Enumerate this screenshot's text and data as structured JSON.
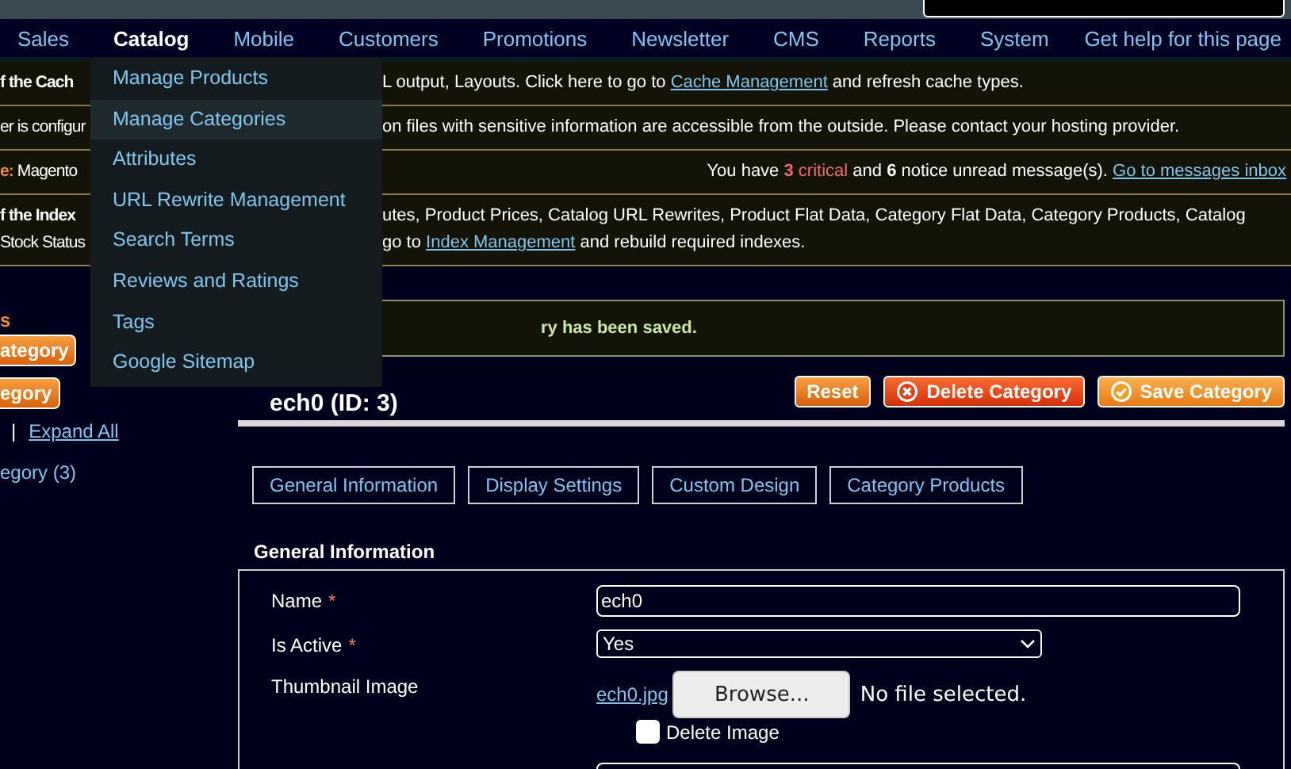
{
  "nav": {
    "items": [
      {
        "label": "Sales",
        "selected": false
      },
      {
        "label": "Catalog",
        "selected": true
      },
      {
        "label": "Mobile",
        "selected": false
      },
      {
        "label": "Customers",
        "selected": false
      },
      {
        "label": "Promotions",
        "selected": false
      },
      {
        "label": "Newsletter",
        "selected": false
      },
      {
        "label": "CMS",
        "selected": false
      },
      {
        "label": "Reports",
        "selected": false
      },
      {
        "label": "System",
        "selected": false
      }
    ],
    "help": "Get help for this page"
  },
  "catalog_menu": {
    "items": [
      {
        "label": "Manage Products",
        "selected": false
      },
      {
        "label": "Manage Categories",
        "selected": true
      },
      {
        "label": "Attributes",
        "selected": false
      },
      {
        "label": "URL Rewrite Management",
        "selected": false
      },
      {
        "label": "Search Terms",
        "selected": false
      },
      {
        "label": "Reviews and Ratings",
        "selected": false
      },
      {
        "label": "Tags",
        "selected": false
      },
      {
        "label": "Google Sitemap",
        "selected": false
      }
    ]
  },
  "messages": [
    {
      "kind": "notice",
      "left": [
        [
          {
            "kind": "bold",
            "text": "f the Cach"
          }
        ]
      ],
      "right": [
        [
          {
            "kind": "text",
            "text": "L output, Layouts. Click here to go to "
          },
          {
            "kind": "link",
            "text": "Cache Management"
          },
          {
            "kind": "text",
            "text": " and refresh cache types."
          }
        ]
      ]
    },
    {
      "kind": "notice",
      "left": [
        [
          {
            "kind": "text",
            "text": "er is configur"
          }
        ]
      ],
      "right": [
        [
          {
            "kind": "text",
            "text": "on files with sensitive information are accessible from the outside. Please contact your hosting provider."
          }
        ]
      ]
    },
    {
      "kind": "inbox",
      "left": [
        [
          {
            "kind": "label",
            "text": "e:"
          },
          {
            "kind": "text",
            "text": " Magento"
          }
        ]
      ],
      "right": [
        [
          {
            "kind": "text",
            "text": "You have "
          },
          {
            "kind": "critical-count",
            "text": "3"
          },
          {
            "kind": "critical",
            "text": " critical"
          },
          {
            "kind": "text",
            "text": " and "
          },
          {
            "kind": "bold",
            "text": "6"
          },
          {
            "kind": "text",
            "text": " notice unread message(s). "
          },
          {
            "kind": "link",
            "text": "Go to messages inbox"
          }
        ]
      ]
    },
    {
      "kind": "notice",
      "left": [
        [
          {
            "kind": "bold",
            "text": "f the Index"
          }
        ],
        [
          {
            "kind": "text",
            "text": "Stock Status"
          }
        ]
      ],
      "right": [
        [
          {
            "kind": "text",
            "text": "utes, Product Prices, Catalog URL Rewrites, Product Flat Data, Category Flat Data, Category Products, Catalog"
          }
        ],
        [
          {
            "kind": "text",
            "text": "go to "
          },
          {
            "kind": "link",
            "text": "Index Management"
          },
          {
            "kind": "text",
            "text": " and rebuild required indexes."
          }
        ]
      ]
    }
  ],
  "sidebar": {
    "heading": "s",
    "buttons": [
      "ategory",
      "egory"
    ],
    "separator": "|",
    "expand_link": "Expand All",
    "tree_item": "egory (3)"
  },
  "success_message": "ry has been saved.",
  "page_title": "ech0 (ID: 3)",
  "actions": [
    {
      "kind": "plain",
      "label": "Reset"
    },
    {
      "kind": "delete",
      "label": "Delete Category"
    },
    {
      "kind": "save",
      "label": "Save Category"
    }
  ],
  "tabs": [
    {
      "label": "General Information",
      "selected": false
    },
    {
      "label": "Display Settings",
      "selected": false
    },
    {
      "label": "Custom Design",
      "selected": false
    },
    {
      "label": "Category Products",
      "selected": false
    }
  ],
  "section_title": "General Information",
  "form": {
    "rows": [
      {
        "kind": "text",
        "label": "Name",
        "required_mark": "*",
        "value": "ech0"
      },
      {
        "kind": "select",
        "label": "Is Active",
        "required_mark": "*",
        "value": "Yes"
      },
      {
        "kind": "image",
        "label": "Thumbnail Image",
        "file_link": "ech0.jpg",
        "browse": "Browse...",
        "no_file": "No file selected.",
        "delete_label": "Delete Image",
        "delete_checked": false
      },
      {
        "kind": "textarea"
      }
    ]
  }
}
